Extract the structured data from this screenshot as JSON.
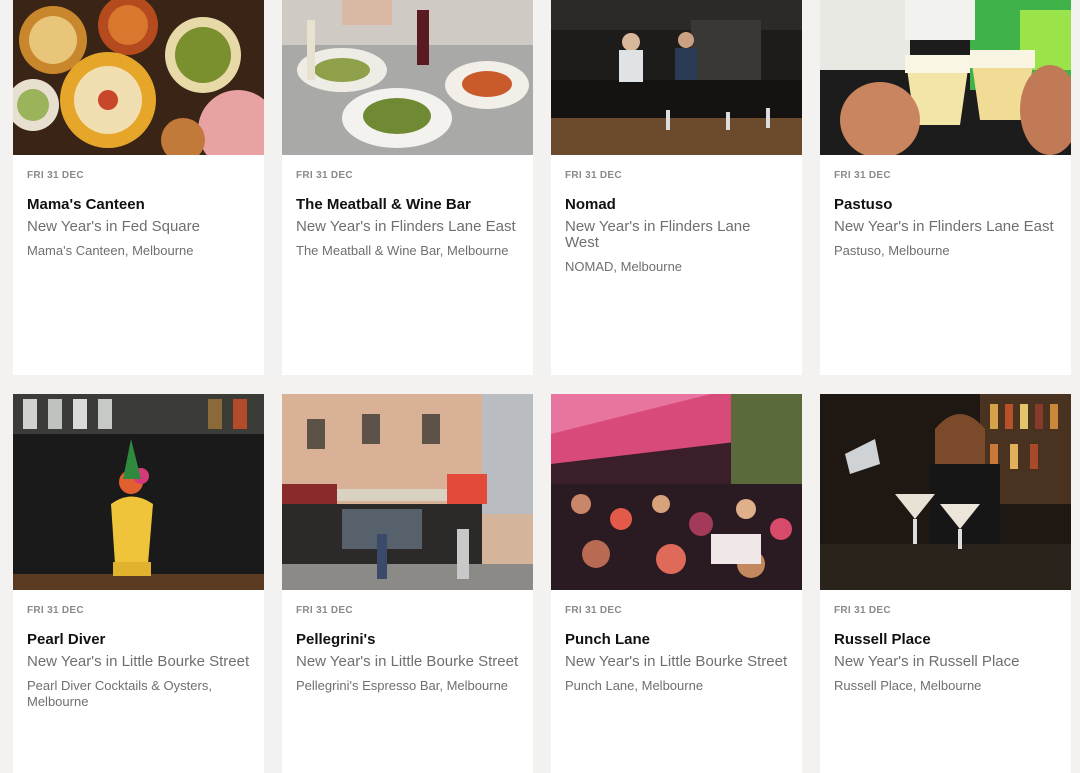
{
  "cards": [
    {
      "date": "FRI 31 DEC",
      "title": "Mama's Canteen",
      "subtitle": "New Year's in Fed Square",
      "venue": "Mama's Canteen, Melbourne",
      "image_icon": "food-spread-photo"
    },
    {
      "date": "FRI 31 DEC",
      "title": "The Meatball & Wine Bar",
      "subtitle": "New Year's in Flinders Lane East",
      "venue": "The Meatball & Wine Bar, Melbourne",
      "image_icon": "meatball-dishes-photo"
    },
    {
      "date": "FRI 31 DEC",
      "title": "Nomad",
      "subtitle": "New Year's in Flinders Lane West",
      "venue": "NOMAD, Melbourne",
      "image_icon": "open-kitchen-photo"
    },
    {
      "date": "FRI 31 DEC",
      "title": "Pastuso",
      "subtitle": "New Year's in Flinders Lane East",
      "venue": "Pastuso, Melbourne",
      "image_icon": "cocktail-toast-photo"
    },
    {
      "date": "FRI 31 DEC",
      "title": "Pearl Diver",
      "subtitle": "New Year's in Little Bourke Street",
      "venue": "Pearl Diver Cocktails & Oysters, Melbourne",
      "image_icon": "tiki-cocktail-photo"
    },
    {
      "date": "FRI 31 DEC",
      "title": "Pellegrini's",
      "subtitle": "New Year's in Little Bourke Street",
      "venue": "Pellegrini's Espresso Bar, Melbourne",
      "image_icon": "storefront-photo"
    },
    {
      "date": "FRI 31 DEC",
      "title": "Punch Lane",
      "subtitle": "New Year's in Little Bourke Street",
      "venue": "Punch Lane, Melbourne",
      "image_icon": "street-dining-photo"
    },
    {
      "date": "FRI 31 DEC",
      "title": "Russell Place",
      "subtitle": "New Year's in Russell Place",
      "venue": "Russell Place, Melbourne",
      "image_icon": "bartender-martinis-photo"
    }
  ]
}
